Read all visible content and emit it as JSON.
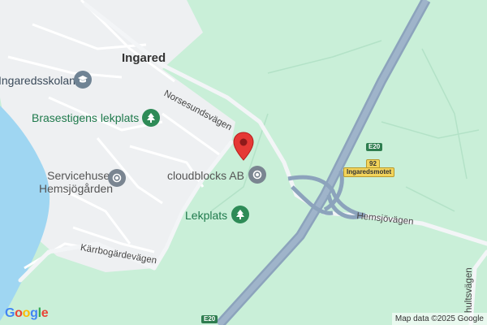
{
  "map": {
    "places": [
      {
        "id": "ingared",
        "label": "Ingared"
      }
    ],
    "pois": [
      {
        "id": "ingaredsskolan",
        "label": "Ingaredsskolan",
        "icon": "school-icon"
      },
      {
        "id": "brasestigens",
        "label": "Brasestigens lekplats",
        "icon": "tree-icon"
      },
      {
        "id": "servicehuset",
        "label": "Servicehuset\nHemsjögården",
        "line1": "Servicehuset",
        "line2": "Hemsjögården",
        "icon": "place-icon"
      },
      {
        "id": "cloudblocks",
        "label": "cloudblocks AB",
        "icon": "place-icon"
      },
      {
        "id": "lekplats",
        "label": "Lekplats",
        "icon": "tree-icon"
      }
    ],
    "roads": [
      {
        "id": "norsesund",
        "label": "Norsesundsvägen"
      },
      {
        "id": "hemsjo",
        "label": "Hemsjövägen"
      },
      {
        "id": "karrbo",
        "label": "Kärrbogärdevägen"
      },
      {
        "id": "hults",
        "label": "hultsvägen"
      }
    ],
    "shields": [
      {
        "id": "e20_top",
        "label": "E20"
      },
      {
        "id": "exit92",
        "label": "92"
      },
      {
        "id": "exit_name",
        "label": "Ingaredsmotet"
      },
      {
        "id": "e20_bottom",
        "label": "E20"
      }
    ],
    "marker": {
      "icon": "map-marker-icon",
      "color": "#e53935"
    },
    "attribution": "Map data ©2025 Google",
    "logo": "Google",
    "colors": {
      "park": "#c9efd8",
      "urban": "#eef0f2",
      "water": "#9fd6f2",
      "highway": "#8ca3bc",
      "poi_green": "#2e8b57",
      "poi_gray": "#7a8591"
    }
  }
}
